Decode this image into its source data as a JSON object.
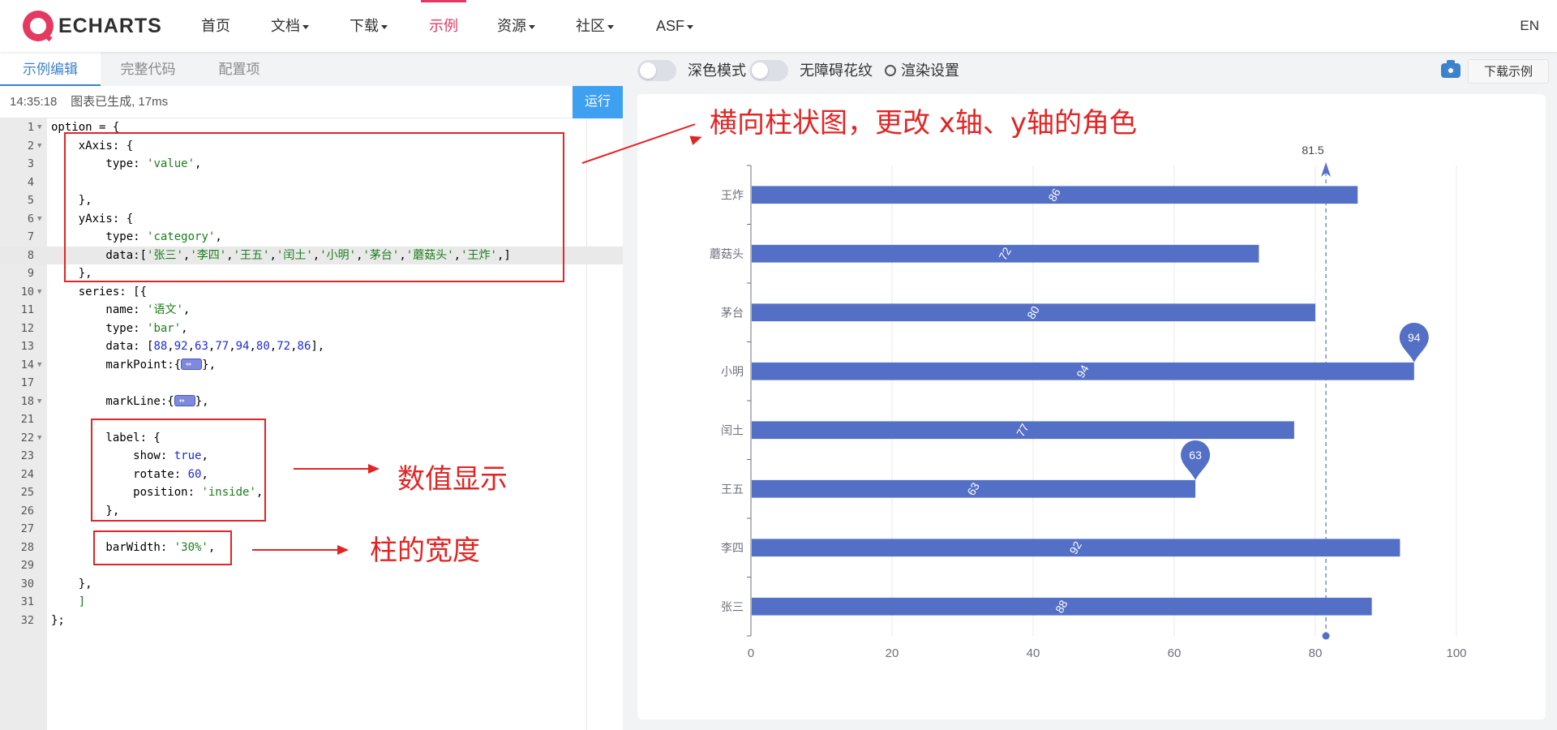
{
  "nav": {
    "logo": "ECHARTS",
    "items": [
      {
        "label": "首页",
        "caret": false,
        "active": false
      },
      {
        "label": "文档",
        "caret": true,
        "active": false
      },
      {
        "label": "下载",
        "caret": true,
        "active": false
      },
      {
        "label": "示例",
        "caret": false,
        "active": true
      },
      {
        "label": "资源",
        "caret": true,
        "active": false
      },
      {
        "label": "社区",
        "caret": true,
        "active": false
      },
      {
        "label": "ASF",
        "caret": true,
        "active": false
      }
    ],
    "lang": "EN"
  },
  "editor_tabs": [
    {
      "label": "示例编辑",
      "active": true
    },
    {
      "label": "完整代码",
      "active": false
    },
    {
      "label": "配置项",
      "active": false
    }
  ],
  "status": {
    "time": "14:35:18",
    "message": "图表已生成, 17ms",
    "run_label": "运行"
  },
  "code_lines": [
    {
      "n": "1",
      "fold": true
    },
    {
      "n": "2",
      "fold": true
    },
    {
      "n": "3",
      "fold": false
    },
    {
      "n": "4",
      "fold": false
    },
    {
      "n": "5",
      "fold": false
    },
    {
      "n": "6",
      "fold": true
    },
    {
      "n": "7",
      "fold": false
    },
    {
      "n": "8",
      "fold": false
    },
    {
      "n": "9",
      "fold": false
    },
    {
      "n": "10",
      "fold": true
    },
    {
      "n": "11",
      "fold": false
    },
    {
      "n": "12",
      "fold": false
    },
    {
      "n": "13",
      "fold": false
    },
    {
      "n": "14",
      "fold": true
    },
    {
      "n": "17",
      "fold": false
    },
    {
      "n": "18",
      "fold": true
    },
    {
      "n": "21",
      "fold": false
    },
    {
      "n": "22",
      "fold": true
    },
    {
      "n": "23",
      "fold": false
    },
    {
      "n": "24",
      "fold": false
    },
    {
      "n": "25",
      "fold": false
    },
    {
      "n": "26",
      "fold": false
    },
    {
      "n": "27",
      "fold": false
    },
    {
      "n": "28",
      "fold": false
    },
    {
      "n": "29",
      "fold": false
    },
    {
      "n": "30",
      "fold": false
    },
    {
      "n": "31",
      "fold": false
    },
    {
      "n": "32",
      "fold": false
    }
  ],
  "code_tokens": [
    [
      {
        "t": "option = {",
        "c": ""
      }
    ],
    [
      {
        "t": "    xAxis: {",
        "c": ""
      }
    ],
    [
      {
        "t": "        type: ",
        "c": ""
      },
      {
        "t": "'value'",
        "c": "s"
      },
      {
        "t": ",",
        "c": ""
      }
    ],
    [
      {
        "t": "",
        "c": ""
      }
    ],
    [
      {
        "t": "    },",
        "c": ""
      }
    ],
    [
      {
        "t": "    yAxis: {",
        "c": ""
      }
    ],
    [
      {
        "t": "        type: ",
        "c": ""
      },
      {
        "t": "'category'",
        "c": "s"
      },
      {
        "t": ",",
        "c": ""
      }
    ],
    [
      {
        "t": "        data:[",
        "c": ""
      },
      {
        "t": "'张三'",
        "c": "s"
      },
      {
        "t": ",",
        "c": ""
      },
      {
        "t": "'李四'",
        "c": "s"
      },
      {
        "t": ",",
        "c": ""
      },
      {
        "t": "'王五'",
        "c": "s"
      },
      {
        "t": ",",
        "c": ""
      },
      {
        "t": "'闰土'",
        "c": "s"
      },
      {
        "t": ",",
        "c": ""
      },
      {
        "t": "'小明'",
        "c": "s"
      },
      {
        "t": ",",
        "c": ""
      },
      {
        "t": "'茅台'",
        "c": "s"
      },
      {
        "t": ",",
        "c": ""
      },
      {
        "t": "'蘑菇头'",
        "c": "s"
      },
      {
        "t": ",",
        "c": ""
      },
      {
        "t": "'王炸'",
        "c": "s"
      },
      {
        "t": ",]",
        "c": ""
      }
    ],
    [
      {
        "t": "    },",
        "c": ""
      }
    ],
    [
      {
        "t": "    series: [{",
        "c": ""
      }
    ],
    [
      {
        "t": "        name: ",
        "c": ""
      },
      {
        "t": "'语文'",
        "c": "s"
      },
      {
        "t": ",",
        "c": ""
      }
    ],
    [
      {
        "t": "        type: ",
        "c": ""
      },
      {
        "t": "'bar'",
        "c": "s"
      },
      {
        "t": ",",
        "c": ""
      }
    ],
    [
      {
        "t": "        data: [",
        "c": ""
      },
      {
        "t": "88",
        "c": "n"
      },
      {
        "t": ",",
        "c": ""
      },
      {
        "t": "92",
        "c": "n"
      },
      {
        "t": ",",
        "c": ""
      },
      {
        "t": "63",
        "c": "n"
      },
      {
        "t": ",",
        "c": ""
      },
      {
        "t": "77",
        "c": "n"
      },
      {
        "t": ",",
        "c": ""
      },
      {
        "t": "94",
        "c": "n"
      },
      {
        "t": ",",
        "c": ""
      },
      {
        "t": "80",
        "c": "n"
      },
      {
        "t": ",",
        "c": ""
      },
      {
        "t": "72",
        "c": "n"
      },
      {
        "t": ",",
        "c": ""
      },
      {
        "t": "86",
        "c": "n"
      },
      {
        "t": "],",
        "c": ""
      }
    ],
    [
      {
        "t": "        markPoint:{",
        "c": ""
      },
      {
        "t": "",
        "c": "fold"
      },
      {
        "t": "},",
        "c": ""
      }
    ],
    [
      {
        "t": "",
        "c": ""
      }
    ],
    [
      {
        "t": "        markLine:{",
        "c": ""
      },
      {
        "t": "",
        "c": "fold"
      },
      {
        "t": "},",
        "c": ""
      }
    ],
    [
      {
        "t": "",
        "c": ""
      }
    ],
    [
      {
        "t": "        label: {",
        "c": ""
      }
    ],
    [
      {
        "t": "            show: ",
        "c": ""
      },
      {
        "t": "true",
        "c": "kw"
      },
      {
        "t": ",",
        "c": ""
      }
    ],
    [
      {
        "t": "            rotate: ",
        "c": ""
      },
      {
        "t": "60",
        "c": "n"
      },
      {
        "t": ",",
        "c": ""
      }
    ],
    [
      {
        "t": "            position: ",
        "c": ""
      },
      {
        "t": "'inside'",
        "c": "s"
      },
      {
        "t": ",",
        "c": ""
      }
    ],
    [
      {
        "t": "        },",
        "c": ""
      }
    ],
    [
      {
        "t": "",
        "c": ""
      }
    ],
    [
      {
        "t": "        barWidth: ",
        "c": ""
      },
      {
        "t": "'30%'",
        "c": "s"
      },
      {
        "t": ",",
        "c": ""
      }
    ],
    [
      {
        "t": "",
        "c": ""
      }
    ],
    [
      {
        "t": "    },",
        "c": ""
      }
    ],
    [
      {
        "t": "    ",
        "c": ""
      },
      {
        "t": "]",
        "c": "s"
      }
    ],
    [
      {
        "t": "};",
        "c": ""
      }
    ]
  ],
  "annotations": {
    "axes_note": "横向柱状图，更改 x轴、y轴的角色",
    "label_note": "数值显示",
    "width_note": "柱的宽度"
  },
  "preview_toolbar": {
    "dark_mode": "深色模式",
    "decal": "无障碍花纹",
    "render_settings": "渲染设置",
    "download": "下载示例"
  },
  "chart_data": {
    "type": "bar",
    "orientation": "horizontal",
    "categories": [
      "张三",
      "李四",
      "王五",
      "闰土",
      "小明",
      "茅台",
      "蘑菇头",
      "王炸"
    ],
    "series": [
      {
        "values": [
          88,
          92,
          63,
          77,
          94,
          80,
          72,
          86
        ],
        "color": "#5470c6"
      }
    ],
    "xlim": [
      0,
      100
    ],
    "x_ticks": [
      0,
      20,
      40,
      60,
      80,
      100
    ],
    "label_rotate": 60,
    "mark_points": [
      {
        "value": 94,
        "category": "小明"
      },
      {
        "value": 63,
        "category": "王五"
      }
    ],
    "mark_line": {
      "value": 81.5,
      "label": "81.5"
    },
    "grid": true
  }
}
